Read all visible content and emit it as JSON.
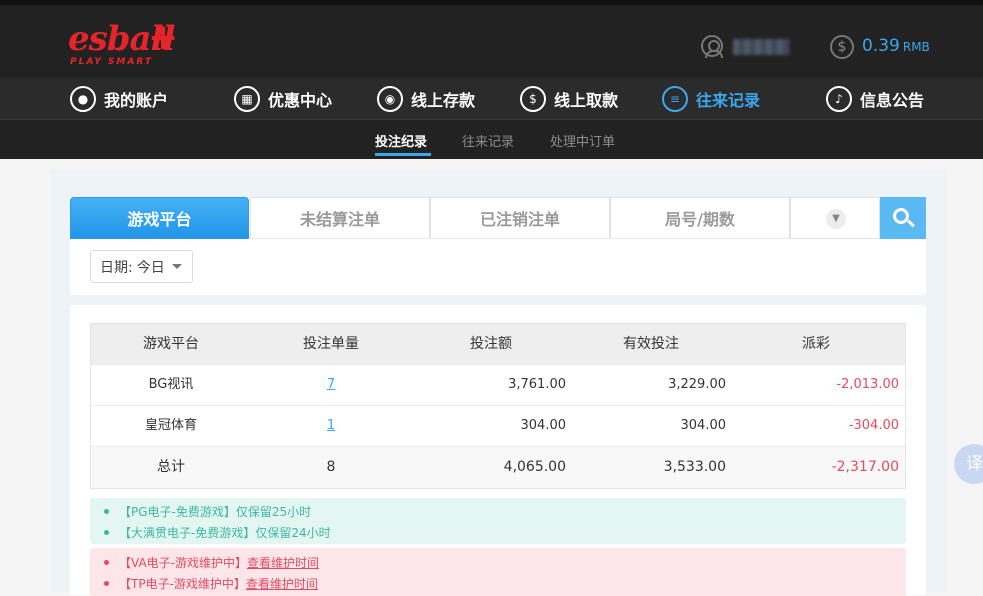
{
  "header": {
    "logo_word": "esball",
    "logo_plus": "+",
    "logo_tagline": "PLAY SMART",
    "balance_value": "0.39",
    "balance_unit": "RMB",
    "brand_color": "#e8242b",
    "accent_color": "#3ba7ee"
  },
  "main_nav": [
    {
      "label": "我的账户",
      "icon": "user-icon",
      "glyph": "●"
    },
    {
      "label": "优惠中心",
      "icon": "gift-icon",
      "glyph": "▦"
    },
    {
      "label": "线上存款",
      "icon": "deposit-icon",
      "glyph": "◉"
    },
    {
      "label": "线上取款",
      "icon": "withdraw-icon",
      "glyph": "$"
    },
    {
      "label": "往来记录",
      "icon": "records-icon",
      "glyph": "≡"
    },
    {
      "label": "信息公告",
      "icon": "bell-icon",
      "glyph": "♪"
    }
  ],
  "sub_nav": [
    {
      "label": "投注纪录"
    },
    {
      "label": "往来记录"
    },
    {
      "label": "处理中订单"
    }
  ],
  "tabs": [
    {
      "label": "游戏平台"
    },
    {
      "label": "未结算注单"
    },
    {
      "label": "已注销注单"
    },
    {
      "label": "局号/期数"
    }
  ],
  "filter": {
    "date_label": "日期:",
    "date_value": "今日"
  },
  "table": {
    "headers": [
      "游戏平台",
      "投注单量",
      "投注额",
      "有效投注",
      "派彩"
    ],
    "rows": [
      {
        "platform": "BG视讯",
        "count": "7",
        "amount": "3,761.00",
        "valid": "3,229.00",
        "payout": "-2,013.00"
      },
      {
        "platform": "皇冠体育",
        "count": "1",
        "amount": "304.00",
        "valid": "304.00",
        "payout": "-304.00"
      }
    ],
    "total": {
      "platform": "总计",
      "count": "8",
      "amount": "4,065.00",
      "valid": "3,533.00",
      "payout": "-2,317.00"
    }
  },
  "notices_free": [
    {
      "text": "【PG电子-免费游戏】仅保留25小时"
    },
    {
      "text": "【大满贯电子-免费游戏】仅保留24小时"
    }
  ],
  "notices_maintenance": [
    {
      "text": "【VA电子-游戏维护中】",
      "link": "查看维护时间"
    },
    {
      "text": "【TP电子-游戏维护中】",
      "link": "查看维护时间"
    }
  ],
  "translate_glyph": "译"
}
